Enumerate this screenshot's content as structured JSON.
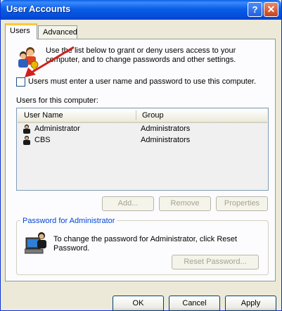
{
  "window": {
    "title": "User Accounts",
    "help_label": "?",
    "close_label": "✕"
  },
  "tabs": [
    {
      "label": "Users"
    },
    {
      "label": "Advanced"
    }
  ],
  "users_tab": {
    "intro_text": "Use the list below to grant or deny users access to your computer, and to change passwords and other settings.",
    "checkbox_label": "Users must enter a user name and password to use this computer.",
    "checkbox_checked": false,
    "list_label": "Users for this computer:",
    "columns": [
      "User Name",
      "Group"
    ],
    "rows": [
      {
        "name": "Administrator",
        "group": "Administrators"
      },
      {
        "name": "CBS",
        "group": "Administrators"
      }
    ],
    "buttons": {
      "add": "Add...",
      "remove": "Remove",
      "properties": "Properties"
    },
    "password_group": {
      "title": "Password for Administrator",
      "text": "To change the password for Administrator, click Reset Password.",
      "reset_button": "Reset Password..."
    }
  },
  "footer": {
    "ok": "OK",
    "cancel": "Cancel",
    "apply": "Apply"
  },
  "annotation": {
    "arrow_color": "#d0201c"
  }
}
